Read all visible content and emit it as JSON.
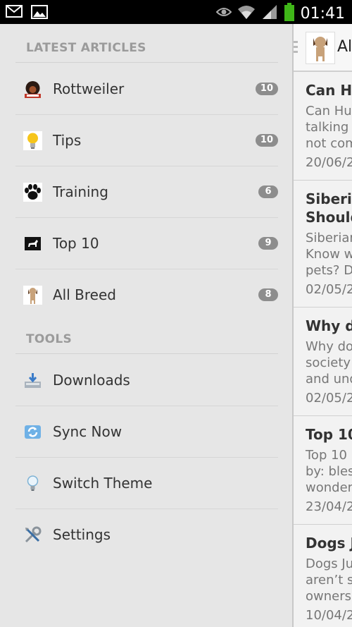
{
  "status_bar": {
    "time": "01:41",
    "icons": [
      "mail-icon",
      "image-icon",
      "eye-icon",
      "wifi-icon",
      "signal-icon",
      "battery-icon"
    ]
  },
  "drawer": {
    "sections": [
      {
        "header": "LATEST ARTICLES",
        "items": [
          {
            "label": "Rottweiler",
            "badge": "10",
            "icon": "rottweiler-icon"
          },
          {
            "label": "Tips",
            "badge": "10",
            "icon": "lightbulb-icon"
          },
          {
            "label": "Training",
            "badge": "6",
            "icon": "paw-icon"
          },
          {
            "label": "Top 10",
            "badge": "9",
            "icon": "dog-silhouette-icon"
          },
          {
            "label": "All Breed",
            "badge": "8",
            "icon": "dog-icon"
          }
        ]
      },
      {
        "header": "TOOLS",
        "items": [
          {
            "label": "Downloads",
            "icon": "download-icon"
          },
          {
            "label": "Sync Now",
            "icon": "sync-icon"
          },
          {
            "label": "Switch Theme",
            "icon": "lightbulb-outline-icon"
          },
          {
            "label": "Settings",
            "icon": "tools-icon"
          }
        ]
      }
    ]
  },
  "content": {
    "title": "Al",
    "articles": [
      {
        "title": [
          "Can Hu"
        ],
        "excerpt": [
          "Can Hus",
          "talking a",
          "not com"
        ],
        "date": "20/06/2"
      },
      {
        "title": [
          "Siberia",
          "Should"
        ],
        "excerpt": [
          "Siberian",
          "Know w",
          "pets? D"
        ],
        "date": "02/05/2"
      },
      {
        "title": [
          "Why do"
        ],
        "excerpt": [
          "Why doe",
          "society",
          "and und"
        ],
        "date": "02/05/2"
      },
      {
        "title": [
          "Top 10"
        ],
        "excerpt": [
          "Top 10",
          "by: bles",
          "wonder"
        ],
        "date": "23/04/2"
      },
      {
        "title": [
          "Dogs J"
        ],
        "excerpt": [
          "Dogs Ju",
          "aren’t sl",
          "owners."
        ],
        "date": "10/04/2"
      }
    ]
  },
  "colors": {
    "drawer_bg": "#e6e6e6",
    "header_text": "#9b9b9b",
    "badge_bg": "#8d8d8d",
    "statusbar_bg": "#000000",
    "battery": "#3fb618"
  }
}
